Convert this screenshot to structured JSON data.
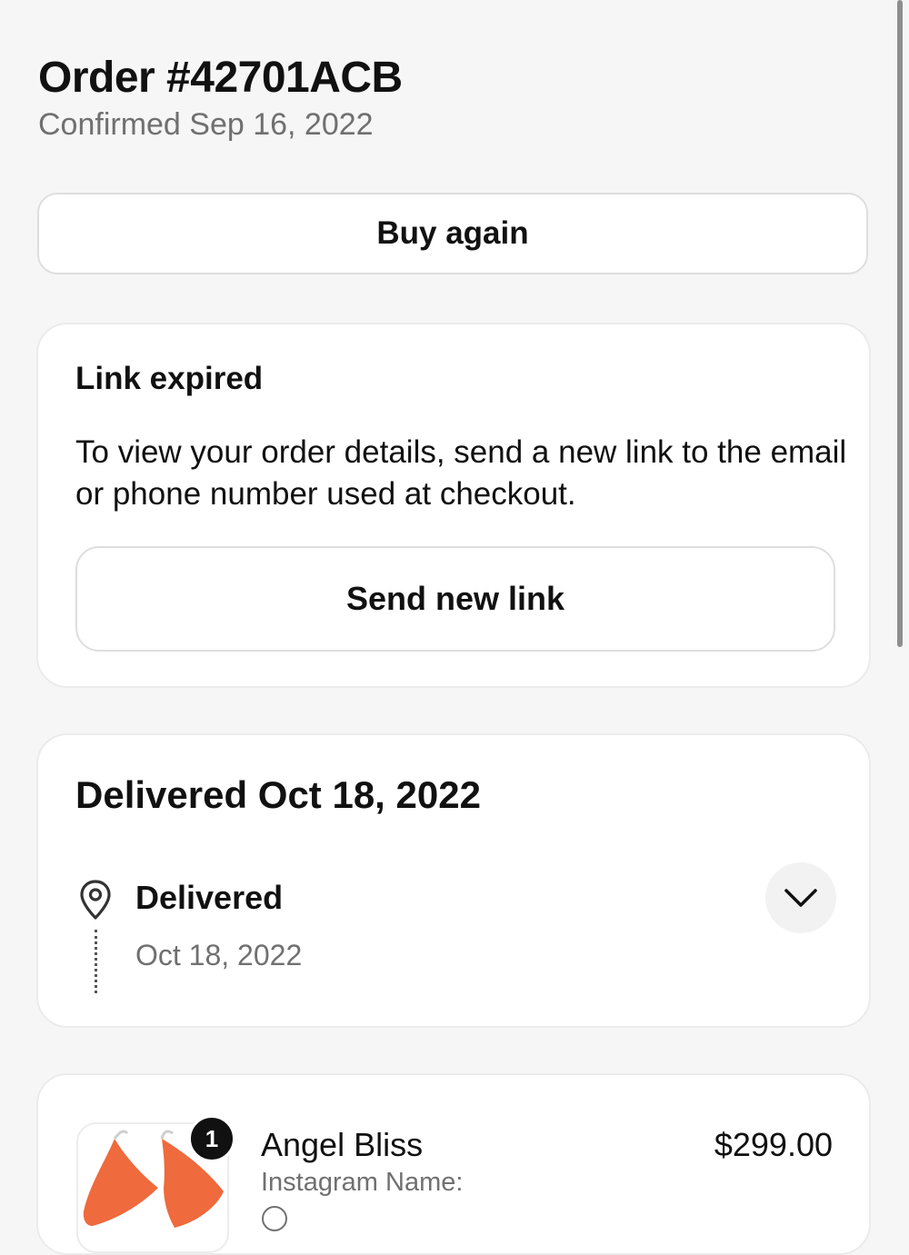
{
  "header": {
    "order_title": "Order #42701ACB",
    "subtitle": "Confirmed Sep 16, 2022"
  },
  "actions": {
    "buy_again_label": "Buy again"
  },
  "link_card": {
    "heading": "Link expired",
    "message": "To view your order details, send a new link to the email or phone number used at checkout.",
    "button_label": "Send new link"
  },
  "delivery_card": {
    "heading": "Delivered Oct 18, 2022",
    "status_label": "Delivered",
    "status_date": "Oct 18, 2022",
    "status_icon": "location-pin-icon",
    "toggle_icon": "chevron-down-icon"
  },
  "item_card": {
    "quantity": "1",
    "name": "Angel Bliss",
    "price": "$299.00",
    "meta": "Instagram Name:",
    "thumbnail_color": "#ef6a3d"
  }
}
